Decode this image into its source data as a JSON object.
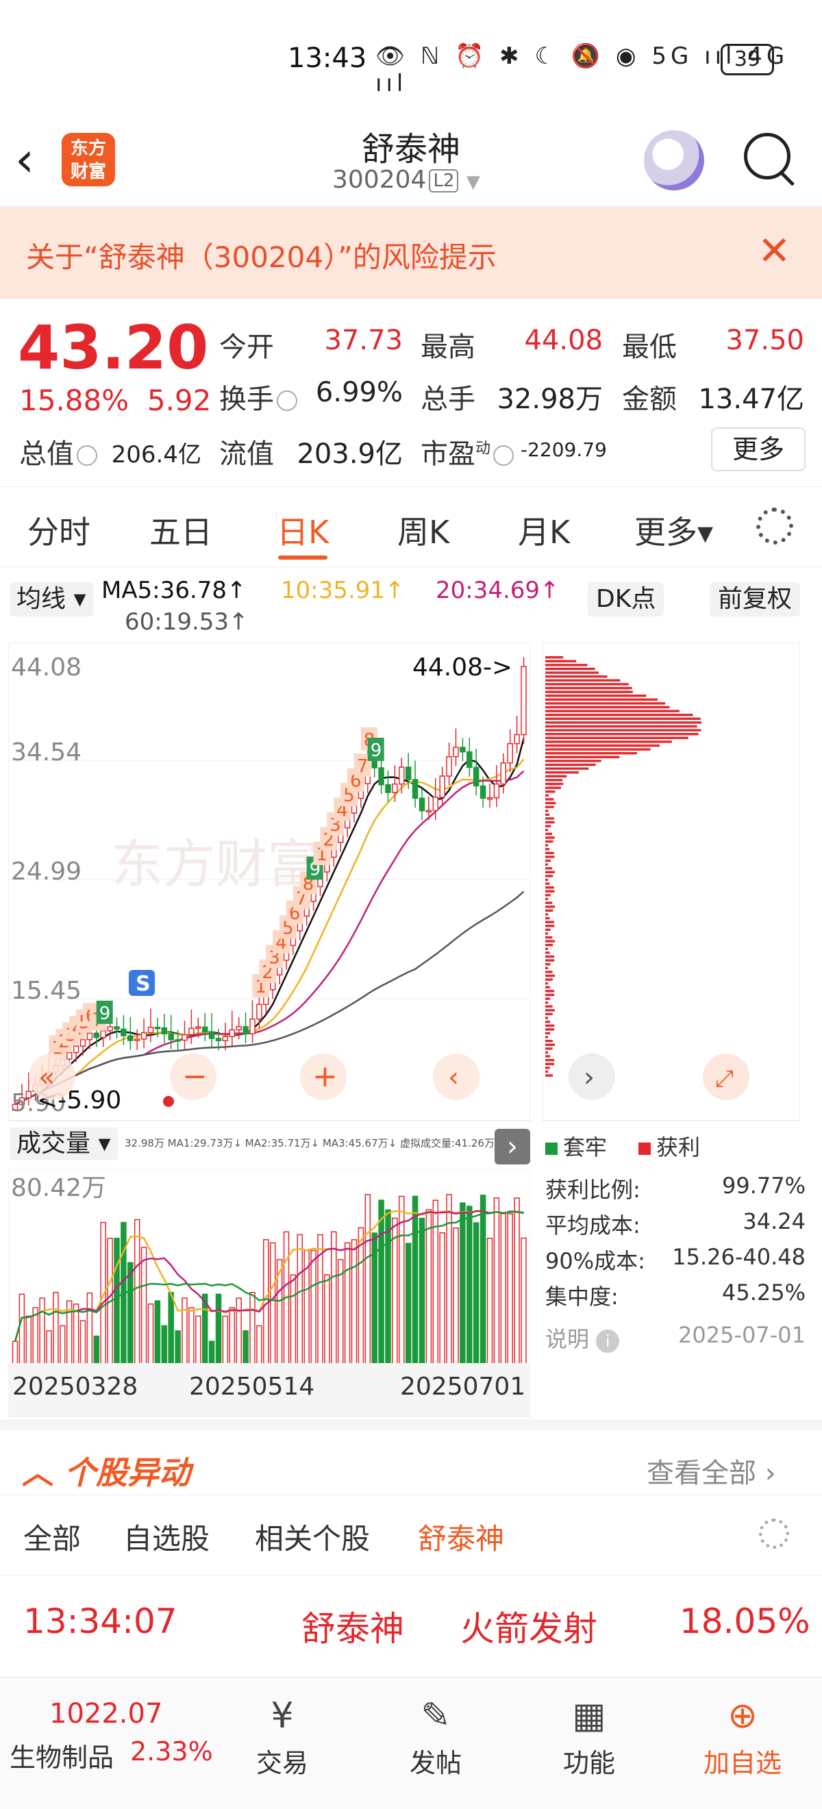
{
  "status_bar": {
    "time": "13:43",
    "icons": "👁 ℕ ⏰ ✱ ☾ 🔕 ◉ 5G ııl 4G ııl",
    "battery": "39"
  },
  "header": {
    "logo_text": "东方\n财富",
    "title": "舒泰神",
    "code": "300204",
    "level": "L2"
  },
  "risk_banner": {
    "text": "关于“舒泰神（300204）”的风险提示",
    "close": "✕"
  },
  "quote": {
    "price": "43.20",
    "change_pct": "15.88%",
    "change": "5.92",
    "open_label": "今开",
    "open": "37.73",
    "high_label": "最高",
    "high": "44.08",
    "low_label": "最低",
    "low": "37.50",
    "turnover_label": "换手",
    "turnover": "6.99%",
    "volume_label": "总手",
    "volume": "32.98万",
    "amount_label": "金额",
    "amount": "13.47亿",
    "mktcap_label": "总值",
    "mktcap": "206.4亿",
    "float_label": "流值",
    "float": "203.9亿",
    "pe_label": "市盈",
    "pe_sup": "动",
    "pe": "-2209.79",
    "more": "更多"
  },
  "tabs": [
    {
      "label": "分时"
    },
    {
      "label": "五日"
    },
    {
      "label": "日K"
    },
    {
      "label": "周K"
    },
    {
      "label": "月K"
    },
    {
      "label": "更多▾"
    }
  ],
  "ma_row": {
    "selector": "均线 ▾",
    "ma5": "MA5:36.78↑",
    "ma10": "10:35.91↑",
    "ma20": "20:34.69↑",
    "ma60": "60:19.53↑",
    "dk": "DK点",
    "adjust": "前复权"
  },
  "colors": {
    "accent": "#f15a22",
    "up": "#e3272d",
    "down": "#1a9a3a",
    "ma5": "#111111",
    "ma10": "#f0b323",
    "ma20": "#c0207a",
    "ma60": "#555555"
  },
  "kchart": {
    "ylabels": [
      "44.08",
      "34.54",
      "24.99",
      "15.45",
      "5.90"
    ],
    "high_marker": "44.08->",
    "low_marker": "<-5.90",
    "watermark": "东方财富",
    "td_marks": [
      "1",
      "2",
      "3",
      "4",
      "5",
      "6",
      "7",
      "9",
      "1",
      "2",
      "3",
      "4",
      "5",
      "6",
      "7",
      "8",
      "9",
      "1",
      "2",
      "3",
      "4",
      "5",
      "6",
      "7",
      "8",
      "9"
    ],
    "s_badge": "S"
  },
  "chart_data": {
    "type": "bar",
    "title": "",
    "ylim": [
      5.9,
      44.08
    ],
    "ma_values": {
      "MA5": 36.78,
      "MA10": 35.91,
      "MA20": 34.69,
      "MA60": 19.53
    },
    "last_close": 43.2,
    "period_high": 44.08,
    "period_low": 5.9,
    "x_ticks": [
      "20250328",
      "20250514",
      "20250701"
    ]
  },
  "volume": {
    "selector": "成交量 ▾",
    "stats": "32.98万  MA1:29.73万↓  MA2:35.71万↓  MA3:45.67万↓  虚拟成交量:41.26万",
    "ymax_label": "80.42万",
    "xlabels": [
      "20250328",
      "20250514",
      "20250701"
    ]
  },
  "chips": {
    "legend_trapped": "套牢",
    "legend_profit": "获利",
    "rows": [
      {
        "label": "获利比例:",
        "value": "99.77%"
      },
      {
        "label": "平均成本:",
        "value": "34.24"
      },
      {
        "label": "90%成本:",
        "value": "15.26-40.48"
      },
      {
        "label": "集中度:",
        "value": "45.25%"
      }
    ],
    "note_label": "说明",
    "date": "2025-07-01"
  },
  "anomaly": {
    "title": "个股异动",
    "view_all": "查看全部",
    "filters": [
      "全部",
      "自选股",
      "相关个股",
      "舒泰神"
    ],
    "row": {
      "time": "13:34:07",
      "name": "舒泰神",
      "event": "火箭发射",
      "pct": "18.05%"
    }
  },
  "bottom_bar": {
    "index_value": "1022.07",
    "index_name": "生物制品",
    "index_pct": "2.33%",
    "items": [
      {
        "label": "交易",
        "icon": "¥"
      },
      {
        "label": "发帖",
        "icon": "✎"
      },
      {
        "label": "功能",
        "icon": "▦"
      },
      {
        "label": "加自选",
        "icon": "⊕"
      }
    ]
  }
}
